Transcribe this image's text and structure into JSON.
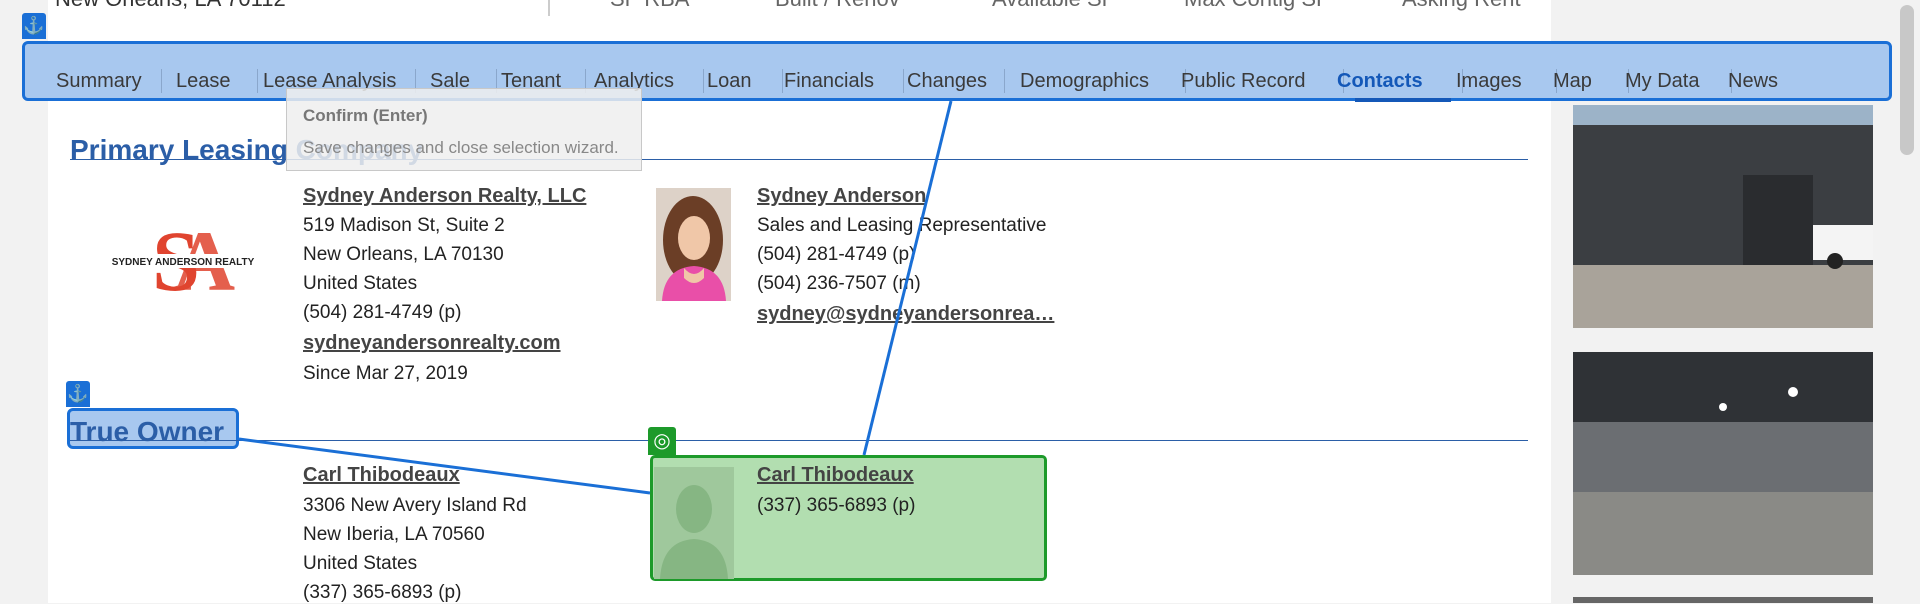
{
  "header": {
    "address": "New Orleans, LA 70112",
    "metrics": [
      "SF RBA",
      "Built / Renov",
      "Available SF",
      "Max Contig SF",
      "Asking Rent"
    ]
  },
  "tabs": [
    "Summary",
    "Lease",
    "Lease Analysis",
    "Sale",
    "Tenant",
    "Analytics",
    "Loan",
    "Financials",
    "Changes",
    "Demographics",
    "Public Record",
    "Contacts",
    "Images",
    "Map",
    "My Data",
    "News"
  ],
  "active_tab": "Contacts",
  "tooltip": {
    "title": "Confirm (Enter)",
    "body": "Save changes and close selection wizard."
  },
  "primary_leasing": {
    "title": "Primary Leasing Company",
    "company": {
      "name": "Sydney Anderson Realty, LLC",
      "address1": "519 Madison St, Suite 2",
      "address2": "New Orleans, LA 70130",
      "country": "United States",
      "phone": "(504) 281-4749 (p)",
      "website": "sydneyandersonrealty.com",
      "since": "Since Mar 27, 2019",
      "logo_text": "SYDNEY ANDERSON REALTY"
    },
    "contact": {
      "name": "Sydney Anderson",
      "role": "Sales and Leasing Representative",
      "phone_p": "(504) 281-4749 (p)",
      "phone_m": "(504) 236-7507 (m)",
      "email": "sydney@sydneyandersonrea…"
    }
  },
  "true_owner": {
    "title": "True Owner",
    "company": {
      "name": "Carl Thibodeaux",
      "address1": "3306 New Avery Island Rd",
      "address2": "New Iberia, LA 70560",
      "country": "United States",
      "phone": "(337) 365-6893 (p)"
    },
    "contact": {
      "name": "Carl Thibodeaux",
      "phone": "(337) 365-6893 (p)"
    }
  },
  "colors": {
    "accent": "#2b5ea7",
    "selection_blue": "#1a6fd6",
    "selection_green": "#1d9a2a"
  },
  "icons": {
    "anchor": "anchor-icon",
    "target": "target-icon"
  }
}
